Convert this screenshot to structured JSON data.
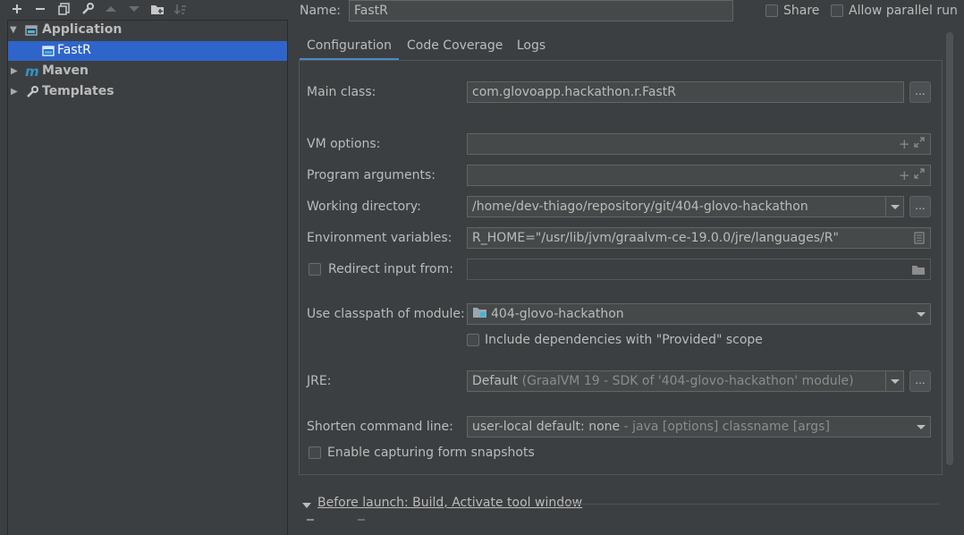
{
  "toolbar": {
    "add_icon": "plus-icon",
    "remove_icon": "minus-icon",
    "copy_icon": "copy-icon",
    "edit_defaults_icon": "wrench-icon",
    "move_up_icon": "arrow-up-icon",
    "move_down_icon": "arrow-down-icon",
    "folder_icon": "new-folder-icon",
    "sort_icon": "sort-icon"
  },
  "tree": {
    "items": [
      {
        "label": "Application",
        "expanded": true
      },
      {
        "label": "FastR",
        "selected": true
      },
      {
        "label": "Maven",
        "expanded": false
      },
      {
        "label": "Templates",
        "expanded": false
      }
    ]
  },
  "header": {
    "name_label": "Name:",
    "name_value": "FastR",
    "share_label": "Share",
    "parallel_label": "Allow parallel run"
  },
  "tabs": [
    "Configuration",
    "Code Coverage",
    "Logs"
  ],
  "form": {
    "main_class_label": "Main class:",
    "main_class_value": "com.glovoapp.hackathon.r.FastR",
    "vm_options_label": "VM options:",
    "vm_options_value": "",
    "program_args_label": "Program arguments:",
    "program_args_value": "",
    "working_dir_label": "Working directory:",
    "working_dir_value": "/home/dev-thiago/repository/git/404-glovo-hackathon",
    "env_vars_label": "Environment variables:",
    "env_vars_value": "R_HOME=\"/usr/lib/jvm/graalvm-ce-19.0.0/jre/languages/R\"",
    "redirect_label": "Redirect input from:",
    "redirect_value": "",
    "classpath_label": "Use classpath of module:",
    "classpath_value": "404-glovo-hackathon",
    "include_deps_label": "Include dependencies with \"Provided\" scope",
    "jre_label": "JRE:",
    "jre_value_main": "Default",
    "jre_value_detail": "(GraalVM 19 - SDK of '404-glovo-hackathon' module)",
    "shorten_label": "Shorten command line:",
    "shorten_value_main": "user-local default: none",
    "shorten_value_detail": "- java [options] classname [args]",
    "snapshots_label": "Enable capturing form snapshots",
    "dots": "..."
  },
  "before_launch": {
    "label": "Before launch: Build, Activate tool window"
  }
}
